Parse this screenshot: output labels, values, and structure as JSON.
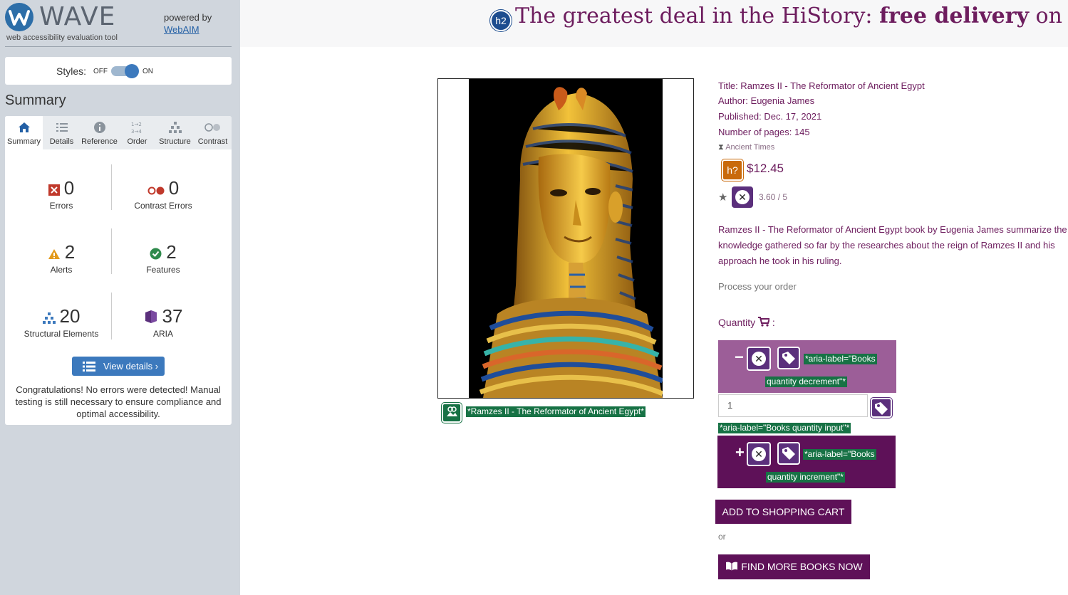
{
  "wave": {
    "logo_text": "WAVE",
    "subtitle": "web accessibility evaluation tool",
    "powered_by": "powered by",
    "webaim_link": "WebAIM",
    "styles_label": "Styles:",
    "styles_off": "OFF",
    "styles_on": "ON",
    "styles_enabled": true,
    "summary_title": "Summary",
    "tabs": [
      {
        "label": "Summary",
        "icon": "home-icon",
        "active": true
      },
      {
        "label": "Details",
        "icon": "list-icon",
        "active": false
      },
      {
        "label": "Reference",
        "icon": "info-icon",
        "active": false
      },
      {
        "label": "Order",
        "icon": "order-icon",
        "active": false
      },
      {
        "label": "Structure",
        "icon": "structure-icon",
        "active": false
      },
      {
        "label": "Contrast",
        "icon": "contrast-icon",
        "active": false
      }
    ],
    "stats": {
      "errors": {
        "count": "0",
        "label": "Errors",
        "color": "#c0392b"
      },
      "contrast_errors": {
        "count": "0",
        "label": "Contrast Errors",
        "color": "#c0392b"
      },
      "alerts": {
        "count": "2",
        "label": "Alerts",
        "color": "#e39a1c"
      },
      "features": {
        "count": "2",
        "label": "Features",
        "color": "#2f8a4c"
      },
      "structural": {
        "count": "20",
        "label": "Structural Elements",
        "color": "#3c79bd"
      },
      "aria": {
        "count": "37",
        "label": "ARIA",
        "color": "#5b2f7c"
      }
    },
    "view_details": "View details ›",
    "congrats": "Congratulations! No errors were detected! Manual testing is still necessary to ensure compliance and optimal accessibility."
  },
  "page": {
    "banner_prefix": "The greatest deal in the HiStory: ",
    "banner_bold": "free delivery",
    "banner_suffix": " on orders over",
    "h2_badge": "h2",
    "image_alt_tag": "*Ramzes II - The Reformator of Ancient Egypt*",
    "title": "Title: Ramzes II - The Reformator of Ancient Egypt",
    "author": "Author: Eugenia James",
    "published": "Published: Dec. 17, 2021",
    "pages": "Number of pages: 145",
    "category": "Ancient Times",
    "hq_badge": "h?",
    "price": "$12.45",
    "rating": "3.60 / 5",
    "description": "Ramzes II - The Reformator of Ancient Egypt book by Eugenia James summarize the knowledge gathered so far by the researches about the reign of Ramzes II and his approach he took in his ruling.",
    "process": "Process your order",
    "quantity_label": "Quantity",
    "quantity_colon": ":",
    "decrement_symbol": "−",
    "decrement_aria_1": "*aria-label=\"Books",
    "decrement_aria_2": "quantity decrement\"*",
    "quantity_value": "1",
    "quantity_aria": "*aria-label=\"Books quantity input\"*",
    "increment_symbol": "+",
    "increment_aria_1": "*aria-label=\"Books",
    "increment_aria_2": "quantity increment\"*",
    "add_to_cart": "ADD TO SHOPPING CART",
    "or": "or",
    "find_more": "FIND MORE BOOKS NOW",
    "accent_color": "#6d1d5e",
    "button_color": "#5e1158"
  }
}
